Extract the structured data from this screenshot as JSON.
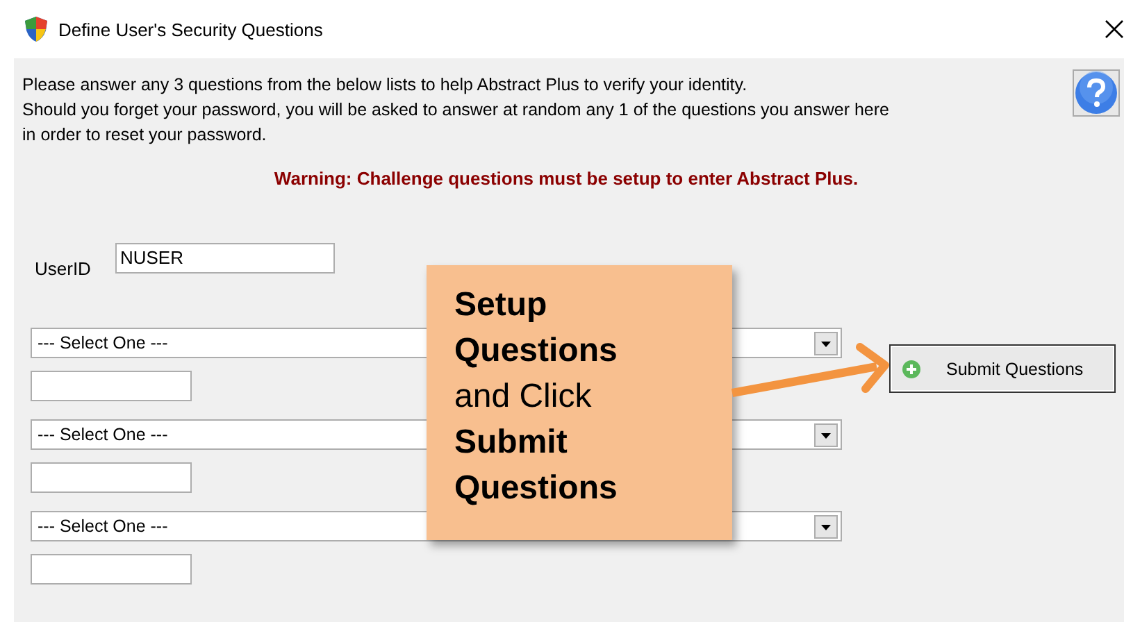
{
  "window": {
    "title": "Define User's Security Questions"
  },
  "instructions": [
    "Please answer any 3 questions from the below lists to help Abstract Plus to verify your identity.",
    "Should you forget your password, you will be asked to answer at random any 1 of the questions you answer here",
    "in order to reset your password."
  ],
  "warning": "Warning: Challenge questions must be setup to enter Abstract Plus.",
  "user_id": {
    "label": "UserID",
    "value": "NUSER"
  },
  "questions": [
    {
      "choice": "--- Select One ---"
    },
    {
      "choice": "--- Select One ---"
    },
    {
      "choice": "--- Select One ---"
    }
  ],
  "submit_button": {
    "label": "Submit Questions"
  },
  "callout": {
    "text": "**Setup Questions** and Click **Submit Questions**"
  }
}
